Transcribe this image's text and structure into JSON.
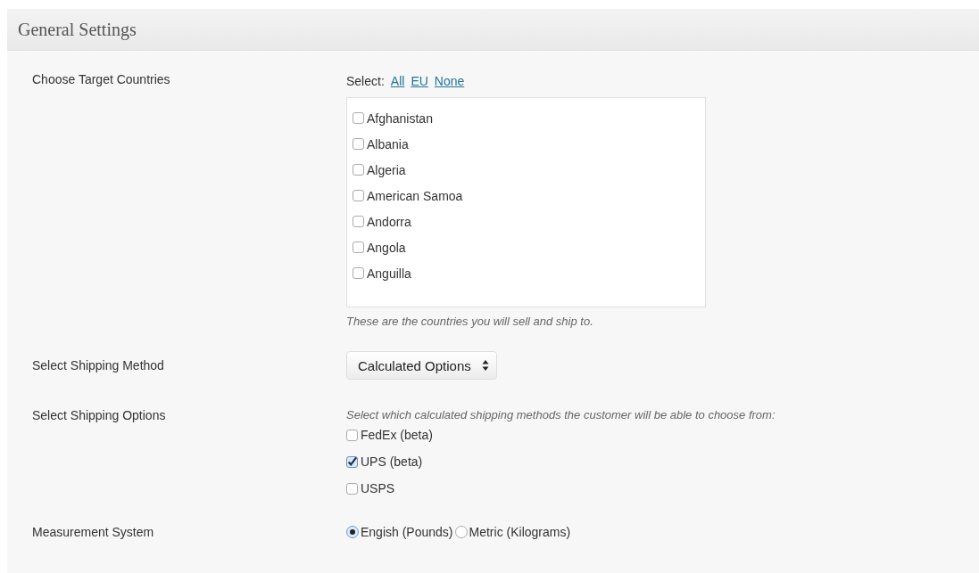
{
  "panel": {
    "title": "General Settings"
  },
  "target_countries": {
    "label": "Choose Target Countries",
    "select_prefix": "Select:",
    "select_links": [
      "All",
      "EU",
      "None"
    ],
    "countries": [
      {
        "name": "Afghanistan",
        "checked": false
      },
      {
        "name": "Albania",
        "checked": false
      },
      {
        "name": "Algeria",
        "checked": false
      },
      {
        "name": "American Samoa",
        "checked": false
      },
      {
        "name": "Andorra",
        "checked": false
      },
      {
        "name": "Angola",
        "checked": false
      },
      {
        "name": "Anguilla",
        "checked": false
      }
    ],
    "hint": "These are the countries you will sell and ship to."
  },
  "shipping_method": {
    "label": "Select Shipping Method",
    "value": "Calculated Options"
  },
  "shipping_options": {
    "label": "Select Shipping Options",
    "hint": "Select which calculated shipping methods the customer will be able to choose from:",
    "options": [
      {
        "name": "FedEx (beta)",
        "checked": false
      },
      {
        "name": "UPS (beta)",
        "checked": true
      },
      {
        "name": "USPS",
        "checked": false
      }
    ]
  },
  "measurement": {
    "label": "Measurement System",
    "options": [
      {
        "name": "Engish (Pounds)",
        "selected": true
      },
      {
        "name": "Metric (Kilograms)",
        "selected": false
      }
    ]
  }
}
